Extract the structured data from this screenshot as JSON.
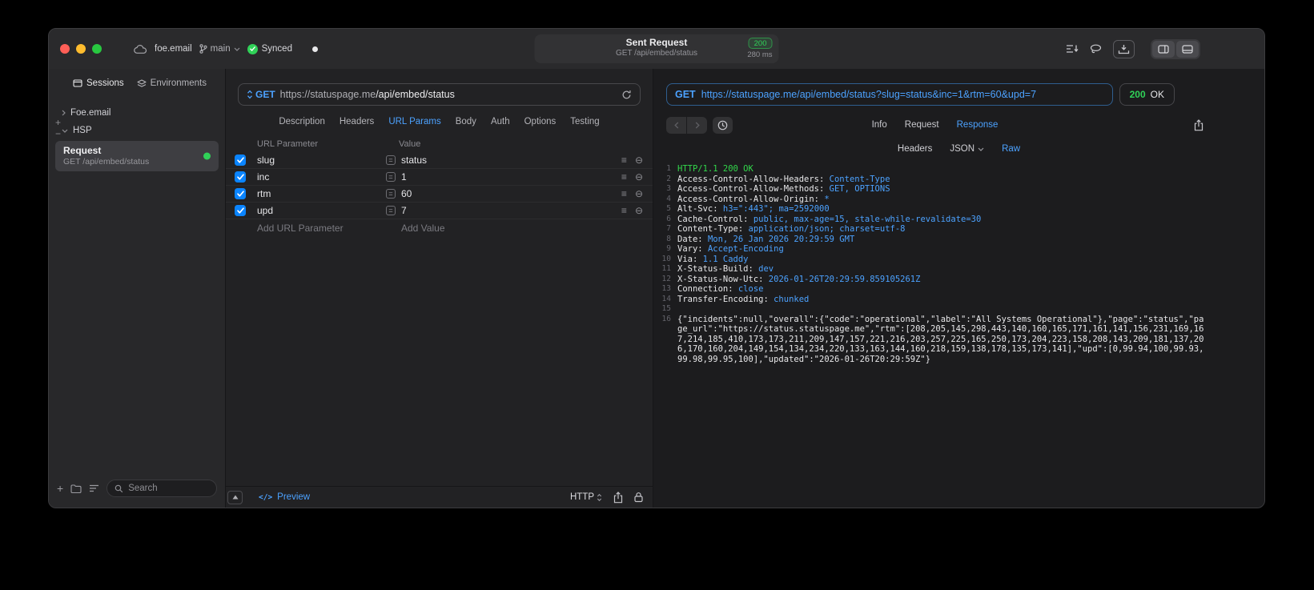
{
  "titlebar": {
    "project": "foe.email",
    "branch": "main",
    "sync_status": "Synced",
    "request_title": "Sent Request",
    "request_subtitle": "GET /api/embed/status",
    "status_code": "200",
    "duration": "280 ms"
  },
  "sidebar": {
    "tabs": [
      {
        "label": "Sessions"
      },
      {
        "label": "Environments"
      }
    ],
    "tree": [
      {
        "label": "Foe.email",
        "expanded": false
      },
      {
        "label": "HSP",
        "expanded": true
      }
    ],
    "request_item": {
      "title": "Request",
      "subtitle": "GET /api/embed/status",
      "status_color": "#30d158"
    },
    "search": {
      "placeholder": "Search"
    }
  },
  "request_panel": {
    "method": "GET",
    "url_host": "https://statuspage.me",
    "url_path": "/api/embed/status",
    "tabs": [
      {
        "label": "Description",
        "active": false
      },
      {
        "label": "Headers",
        "active": false
      },
      {
        "label": "URL Params",
        "active": true
      },
      {
        "label": "Body",
        "active": false
      },
      {
        "label": "Auth",
        "active": false
      },
      {
        "label": "Options",
        "active": false
      },
      {
        "label": "Testing",
        "active": false
      }
    ],
    "params": {
      "columns": [
        "URL Parameter",
        "Value"
      ],
      "rows": [
        {
          "name": "slug",
          "value": "status",
          "enabled": true
        },
        {
          "name": "inc",
          "value": "1",
          "enabled": true
        },
        {
          "name": "rtm",
          "value": "60",
          "enabled": true
        },
        {
          "name": "upd",
          "value": "7",
          "enabled": true
        }
      ],
      "add_name_placeholder": "Add URL Parameter",
      "add_value_placeholder": "Add Value"
    },
    "footer": {
      "preview_label": "Preview",
      "protocol": "HTTP"
    }
  },
  "response_panel": {
    "method": "GET",
    "url": "https://statuspage.me/api/embed/status?slug=status&inc=1&rtm=60&upd=7",
    "status_code": "200",
    "status_text": "OK",
    "tabs": [
      {
        "label": "Info",
        "active": false
      },
      {
        "label": "Request",
        "active": false
      },
      {
        "label": "Response",
        "active": true
      }
    ],
    "view_tabs": [
      {
        "label": "Headers",
        "active": false
      },
      {
        "label": "JSON",
        "active": false
      },
      {
        "label": "Raw",
        "active": true
      }
    ],
    "code_lines": [
      {
        "num": "1",
        "segments": [
          {
            "text": "HTTP/1.1 200 OK",
            "color": "green"
          }
        ]
      },
      {
        "num": "2",
        "segments": [
          {
            "text": "Access-Control-Allow-Headers: ",
            "color": "plain"
          },
          {
            "text": "Content-Type",
            "color": "blue"
          }
        ]
      },
      {
        "num": "3",
        "segments": [
          {
            "text": "Access-Control-Allow-Methods: ",
            "color": "plain"
          },
          {
            "text": "GET, OPTIONS",
            "color": "blue"
          }
        ]
      },
      {
        "num": "4",
        "segments": [
          {
            "text": "Access-Control-Allow-Origin: ",
            "color": "plain"
          },
          {
            "text": "*",
            "color": "blue"
          }
        ]
      },
      {
        "num": "5",
        "segments": [
          {
            "text": "Alt-Svc: ",
            "color": "plain"
          },
          {
            "text": "h3=\":443\"; ma=2592000",
            "color": "blue"
          }
        ]
      },
      {
        "num": "6",
        "segments": [
          {
            "text": "Cache-Control: ",
            "color": "plain"
          },
          {
            "text": "public, max-age=15, stale-while-revalidate=30",
            "color": "blue"
          }
        ]
      },
      {
        "num": "7",
        "segments": [
          {
            "text": "Content-Type: ",
            "color": "plain"
          },
          {
            "text": "application/json; charset=utf-8",
            "color": "blue"
          }
        ]
      },
      {
        "num": "8",
        "segments": [
          {
            "text": "Date: ",
            "color": "plain"
          },
          {
            "text": "Mon, 26 Jan 2026 20:29:59 GMT",
            "color": "blue"
          }
        ]
      },
      {
        "num": "9",
        "segments": [
          {
            "text": "Vary: ",
            "color": "plain"
          },
          {
            "text": "Accept-Encoding",
            "color": "blue"
          }
        ]
      },
      {
        "num": "10",
        "segments": [
          {
            "text": "Via: ",
            "color": "plain"
          },
          {
            "text": "1.1 Caddy",
            "color": "blue"
          }
        ]
      },
      {
        "num": "11",
        "segments": [
          {
            "text": "X-Status-Build: ",
            "color": "plain"
          },
          {
            "text": "dev",
            "color": "blue"
          }
        ]
      },
      {
        "num": "12",
        "segments": [
          {
            "text": "X-Status-Now-Utc: ",
            "color": "plain"
          },
          {
            "text": "2026-01-26T20:29:59.859105261Z",
            "color": "blue"
          }
        ]
      },
      {
        "num": "13",
        "segments": [
          {
            "text": "Connection: ",
            "color": "plain"
          },
          {
            "text": "close",
            "color": "blue"
          }
        ]
      },
      {
        "num": "14",
        "segments": [
          {
            "text": "Transfer-Encoding: ",
            "color": "plain"
          },
          {
            "text": "chunked",
            "color": "blue"
          }
        ]
      },
      {
        "num": "15",
        "segments": []
      },
      {
        "num": "16",
        "segments": [
          {
            "text": "{\"incidents\":null,\"overall\":{\"code\":\"operational\",\"label\":\"All Systems Operational\"},\"page\":\"status\",\"page_url\":\"https://status.statuspage.me\",\"rtm\":[208,205,145,298,443,140,160,165,171,161,141,156,231,169,167,214,185,410,173,173,211,209,147,157,221,216,203,257,225,165,250,173,204,223,158,208,143,209,181,137,206,170,160,204,149,154,134,234,220,133,163,144,160,218,159,138,178,135,173,141],\"upd\":[0,99.94,100,99.93,99.98,99.95,100],\"updated\":\"2026-01-26T20:29:59Z\"}",
            "color": "plain"
          }
        ]
      }
    ]
  },
  "icons": {
    "equals": "=",
    "menu": "≡",
    "remove": "⊖",
    "plus": "+",
    "minus": "−",
    "code": "</>"
  },
  "colors": {
    "accent_blue": "#4ca2ff",
    "green": "#30d158",
    "checkbox_blue": "#0a84ff",
    "status_green": "#32d74b"
  }
}
